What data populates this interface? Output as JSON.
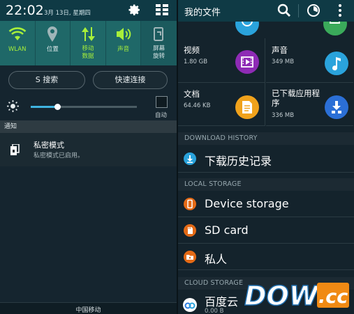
{
  "status": {
    "time": "22:02",
    "date": "3月 13日, 星期四"
  },
  "quick_settings": [
    {
      "label": "WLAN",
      "icon": "wifi-icon",
      "on": true
    },
    {
      "label": "位置",
      "icon": "location-icon",
      "on": false
    },
    {
      "label": "移动\n数据",
      "icon": "mobile-data-icon",
      "on": true
    },
    {
      "label": "声音",
      "icon": "sound-icon",
      "on": true
    },
    {
      "label": "屏幕\n旋转",
      "icon": "screen-rotate-icon",
      "on": false
    }
  ],
  "buttons": {
    "s_search": "S 搜索",
    "quick_connect": "快速连接"
  },
  "brightness": {
    "level": 0.25,
    "auto_label": "自动"
  },
  "notifications": {
    "header": "通知",
    "items": [
      {
        "title": "私密模式",
        "subtitle": "私密模式已启用。"
      }
    ]
  },
  "carrier": "中国移动",
  "my_files": {
    "title": "我的文件",
    "categories": [
      {
        "name": "视频",
        "size": "1.80 GB",
        "icon": "video-icon",
        "color": "#8e2bb5"
      },
      {
        "name": "声音",
        "size": "349 MB",
        "icon": "music-icon",
        "color": "#2aa3dc"
      },
      {
        "name": "文档",
        "size": "64.46 KB",
        "icon": "document-icon",
        "color": "#f0a21c"
      },
      {
        "name": "已下载应用程序",
        "size": "336 MB",
        "icon": "download-app-icon",
        "color": "#2b6fd6"
      }
    ],
    "download_history": {
      "header": "DOWNLOAD HISTORY",
      "item": "下载历史记录"
    },
    "local_storage": {
      "header": "LOCAL STORAGE",
      "items": [
        {
          "label": "Device storage"
        },
        {
          "label": "SD card"
        },
        {
          "label": "私人"
        }
      ]
    },
    "cloud_storage": {
      "header": "CLOUD STORAGE",
      "items": [
        {
          "label": "百度云",
          "size": "0.00 B"
        }
      ]
    }
  },
  "watermark": {
    "text": "DOWN",
    "suffix": ".cc"
  },
  "colors": {
    "accent": "#a8f03a",
    "header_bg": "#0f3a45",
    "tile_bg": "#1f6868",
    "slider": "#3fb4e0"
  }
}
